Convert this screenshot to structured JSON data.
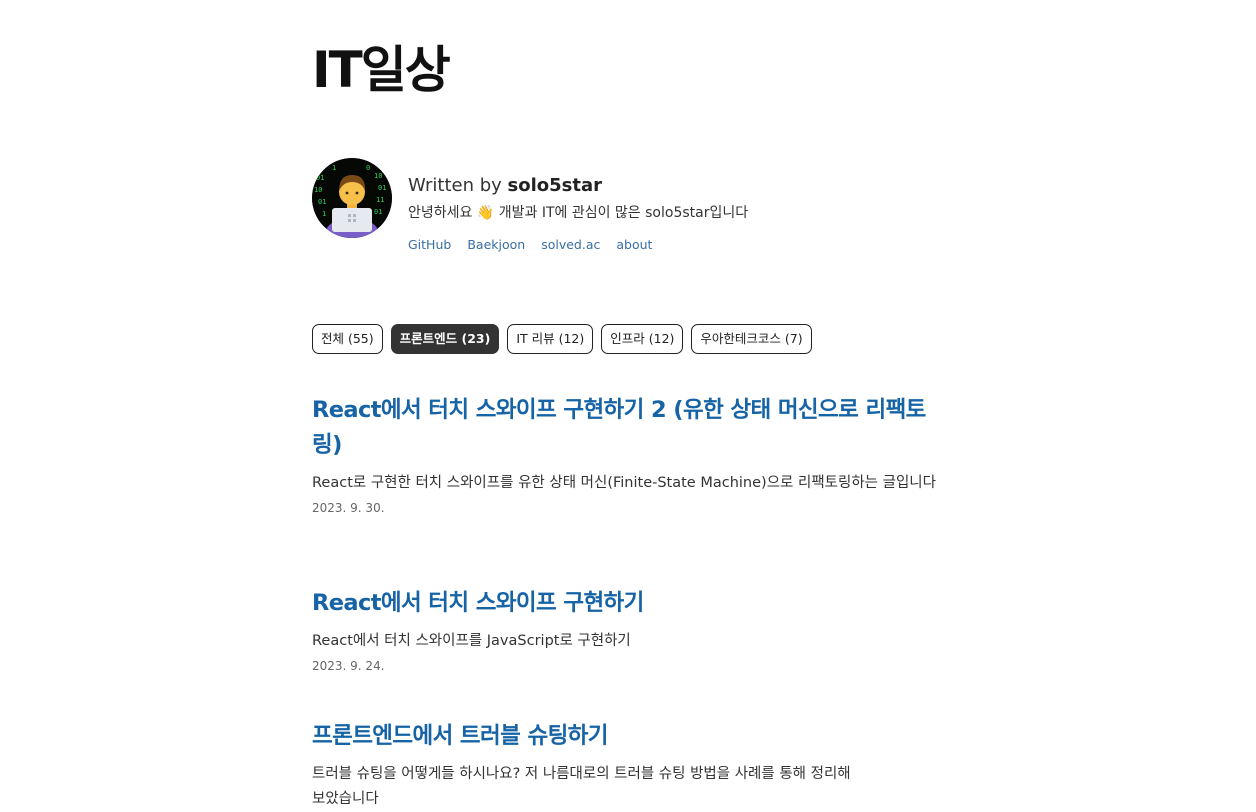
{
  "site": {
    "title": "IT일상"
  },
  "bio": {
    "written_prefix": "Written by ",
    "author": "solo5star",
    "intro": "안녕하세요 👋 개발과 IT에 관심이 많은 solo5star입니다",
    "links": [
      {
        "label": "GitHub"
      },
      {
        "label": "Baekjoon"
      },
      {
        "label": "solved.ac"
      },
      {
        "label": "about"
      }
    ]
  },
  "categories": [
    {
      "label": "전체 (55)",
      "active": false
    },
    {
      "label": "프론트엔드 (23)",
      "active": true
    },
    {
      "label": "IT 리뷰 (12)",
      "active": false
    },
    {
      "label": "인프라 (12)",
      "active": false
    },
    {
      "label": "우아한테크코스 (7)",
      "active": false
    }
  ],
  "posts": [
    {
      "title": "React에서 터치 스와이프 구현하기 2 (유한 상태 머신으로 리팩토링)",
      "description": "React로 구현한 터치 스와이프를 유한 상태 머신(Finite-State Machine)으로 리팩토링하는 글입니다",
      "date": "2023. 9. 30."
    },
    {
      "title": "React에서 터치 스와이프 구현하기",
      "description": "React에서 터치 스와이프를 JavaScript로 구현하기",
      "date": "2023. 9. 24."
    },
    {
      "title": "프론트엔드에서 트러블 슈팅하기",
      "description": "트러블 슈팅을 어떻게들 하시나요? 저 나름대로의 트러블 슈팅 방법을 사례를 통해 정리해보았습니다",
      "date": ""
    }
  ],
  "colors": {
    "link": "#3a6ea5",
    "post_title": "#1663a6",
    "active_chip": "#333333"
  }
}
